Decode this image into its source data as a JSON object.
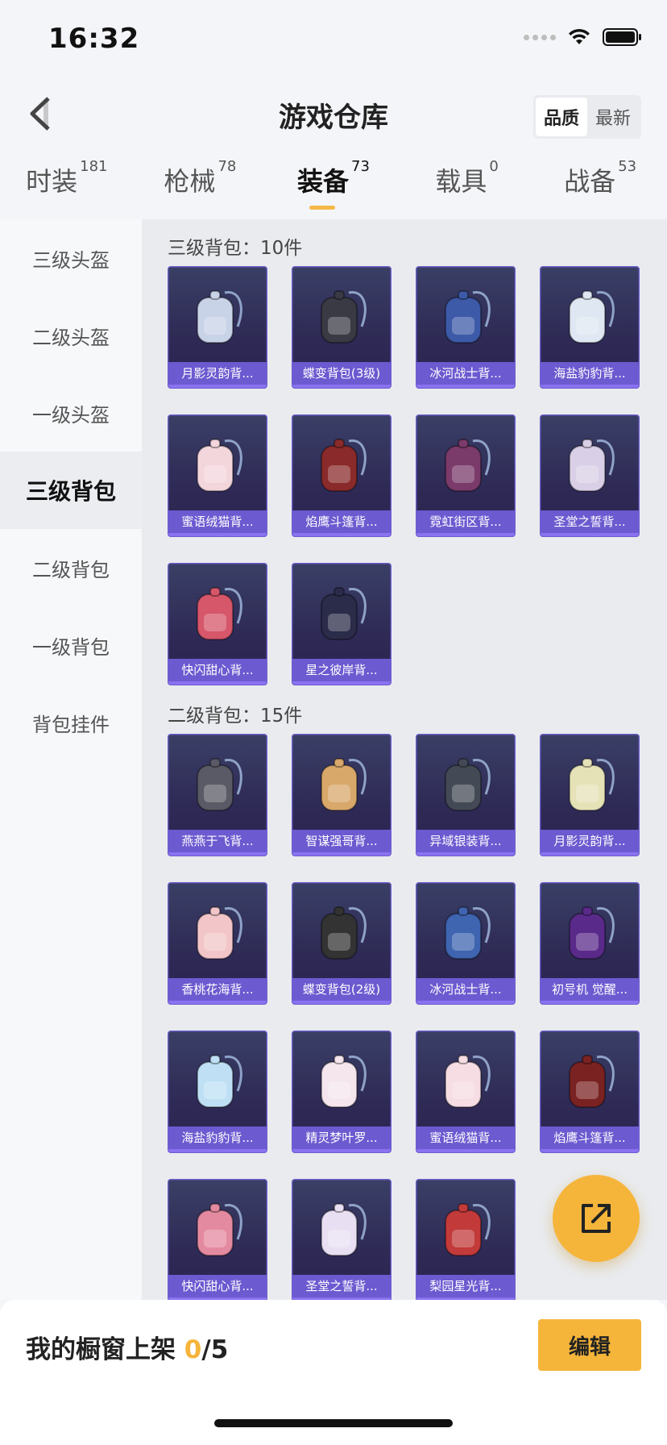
{
  "status_bar": {
    "time": "16:32"
  },
  "header": {
    "title": "游戏仓库",
    "sort_options": [
      "品质",
      "最新"
    ]
  },
  "tabs": [
    {
      "label": "时装",
      "count": "181"
    },
    {
      "label": "枪械",
      "count": "78"
    },
    {
      "label": "装备",
      "count": "73",
      "active": true
    },
    {
      "label": "载具",
      "count": "0"
    },
    {
      "label": "战备",
      "count": "53"
    }
  ],
  "sidebar": {
    "items": [
      {
        "label": "三级头盔"
      },
      {
        "label": "二级头盔"
      },
      {
        "label": "一级头盔"
      },
      {
        "label": "三级背包",
        "active": true
      },
      {
        "label": "二级背包"
      },
      {
        "label": "一级背包"
      },
      {
        "label": "背包挂件"
      }
    ]
  },
  "sections": [
    {
      "title": "三级背包：10件",
      "items": [
        {
          "name": "月影灵韵背..."
        },
        {
          "name": "蝶变背包(3级)"
        },
        {
          "name": "冰河战士背..."
        },
        {
          "name": "海盐豹豹背..."
        },
        {
          "name": "蜜语绒猫背..."
        },
        {
          "name": "焰鹰斗篷背..."
        },
        {
          "name": "霓虹街区背..."
        },
        {
          "name": "圣堂之誓背..."
        },
        {
          "name": "快闪甜心背..."
        },
        {
          "name": "星之彼岸背..."
        }
      ]
    },
    {
      "title": "二级背包：15件",
      "items": [
        {
          "name": "燕燕于飞背..."
        },
        {
          "name": "智谋强哥背..."
        },
        {
          "name": "异域银装背..."
        },
        {
          "name": "月影灵韵背..."
        },
        {
          "name": "香桃花海背..."
        },
        {
          "name": "蝶变背包(2级)"
        },
        {
          "name": "冰河战士背..."
        },
        {
          "name": "初号机 觉醒..."
        },
        {
          "name": "海盐豹豹背..."
        },
        {
          "name": "精灵梦叶罗..."
        },
        {
          "name": "蜜语绒猫背..."
        },
        {
          "name": "焰鹰斗篷背..."
        },
        {
          "name": "快闪甜心背..."
        },
        {
          "name": "圣堂之誓背..."
        },
        {
          "name": "梨园星光背..."
        }
      ]
    }
  ],
  "bottom_bar": {
    "shelf_label": "我的橱窗上架",
    "shelf_current": "0",
    "shelf_total": "/5",
    "edit_label": "编辑"
  },
  "colors": {
    "accent": "#f5b53a",
    "card_bg": "#2e2a55",
    "card_label_bg": "#7864e6",
    "card_border": "#6b5fcf"
  }
}
